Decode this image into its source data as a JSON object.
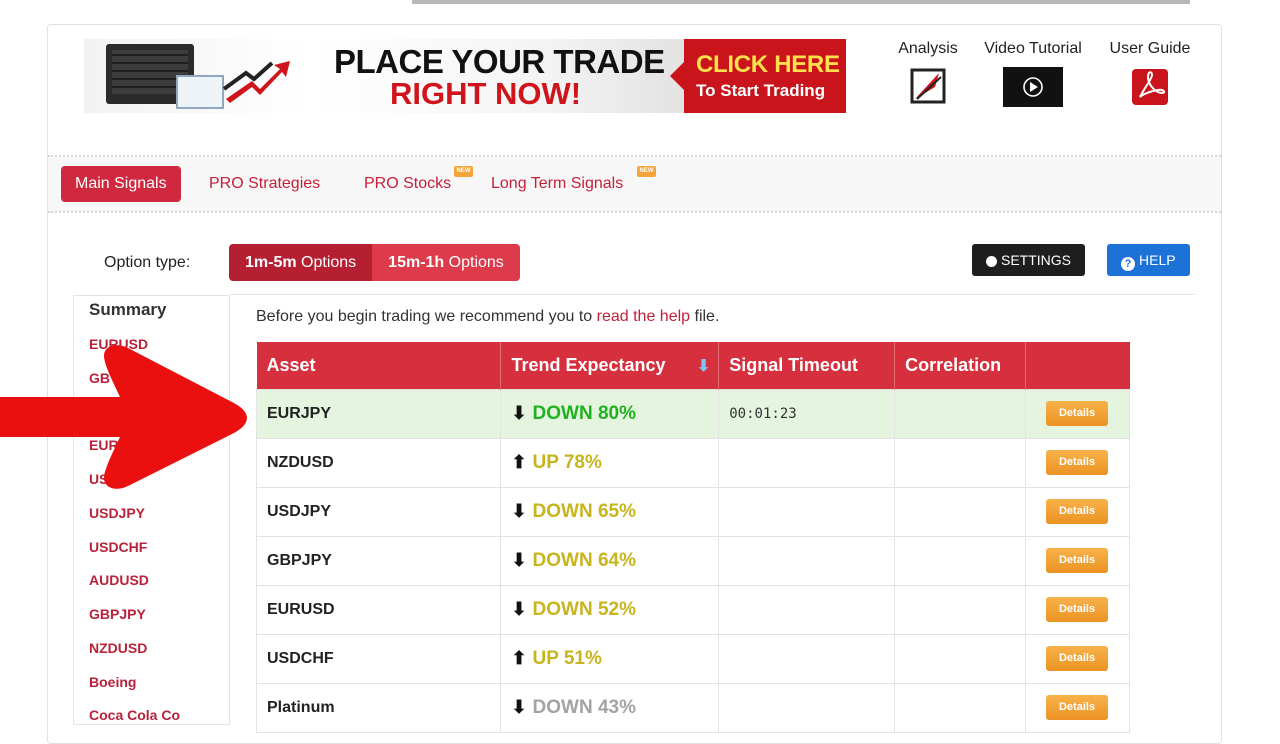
{
  "banner": {
    "line1": "PLACE YOUR TRADE",
    "line2": "RIGHT NOW!",
    "cta_line1": "CLICK HERE",
    "cta_line2": "To Start Trading"
  },
  "header_links": [
    {
      "label": "Analysis",
      "icon": "analysis-icon"
    },
    {
      "label": "Video Tutorial",
      "icon": "play-icon"
    },
    {
      "label": "User Guide",
      "icon": "pdf-icon"
    }
  ],
  "nav": {
    "items": [
      {
        "label": "Main Signals",
        "active": true,
        "new": false
      },
      {
        "label": "PRO Strategies",
        "active": false,
        "new": false
      },
      {
        "label": "PRO Stocks",
        "active": false,
        "new": true
      },
      {
        "label": "Long Term Signals",
        "active": false,
        "new": true
      }
    ],
    "new_badge": "NEW"
  },
  "options": {
    "label": "Option type:",
    "btn1_bold": "1m-5m",
    "btn1_rest": " Options",
    "btn2_bold": "15m-1h",
    "btn2_rest": " Options",
    "active": "1m-5m"
  },
  "toolbar": {
    "settings_label": "SETTINGS",
    "help_label": "HELP"
  },
  "sidebar": {
    "heading": "Summary",
    "items": [
      "EURUSD",
      "GB",
      "EUR",
      "USD",
      "USDJPY",
      "USDCHF",
      "AUDUSD",
      "GBPJPY",
      "NZDUSD",
      "Boeing",
      "Coca Cola Co"
    ]
  },
  "note": {
    "before": "Before you begin trading we recommend you to ",
    "link": "read the help",
    "after": " file."
  },
  "table": {
    "headers": [
      "Asset",
      "Trend Expectancy",
      "Signal Timeout",
      "Correlation",
      ""
    ],
    "details_label": "Details",
    "rows": [
      {
        "asset": "EURJPY",
        "dir": "down",
        "trend": "DOWN 80%",
        "timeout": "00:01:23",
        "color": "green",
        "highlight": true
      },
      {
        "asset": "NZDUSD",
        "dir": "up",
        "trend": "UP 78%",
        "timeout": "",
        "color": "gold",
        "highlight": false
      },
      {
        "asset": "USDJPY",
        "dir": "down",
        "trend": "DOWN 65%",
        "timeout": "",
        "color": "gold",
        "highlight": false
      },
      {
        "asset": "GBPJPY",
        "dir": "down",
        "trend": "DOWN 64%",
        "timeout": "",
        "color": "gold",
        "highlight": false
      },
      {
        "asset": "EURUSD",
        "dir": "down",
        "trend": "DOWN 52%",
        "timeout": "",
        "color": "gold",
        "highlight": false
      },
      {
        "asset": "USDCHF",
        "dir": "up",
        "trend": "UP 51%",
        "timeout": "",
        "color": "gold",
        "highlight": false
      },
      {
        "asset": "Platinum",
        "dir": "down",
        "trend": "DOWN 43%",
        "timeout": "",
        "color": "grey",
        "highlight": false
      }
    ]
  },
  "colors": {
    "brand_red": "#d6303f",
    "trend_green": "#1fb21f",
    "trend_gold": "#c8b41c",
    "trend_grey": "#a3a3a3",
    "details_orange": "#ec9323"
  }
}
